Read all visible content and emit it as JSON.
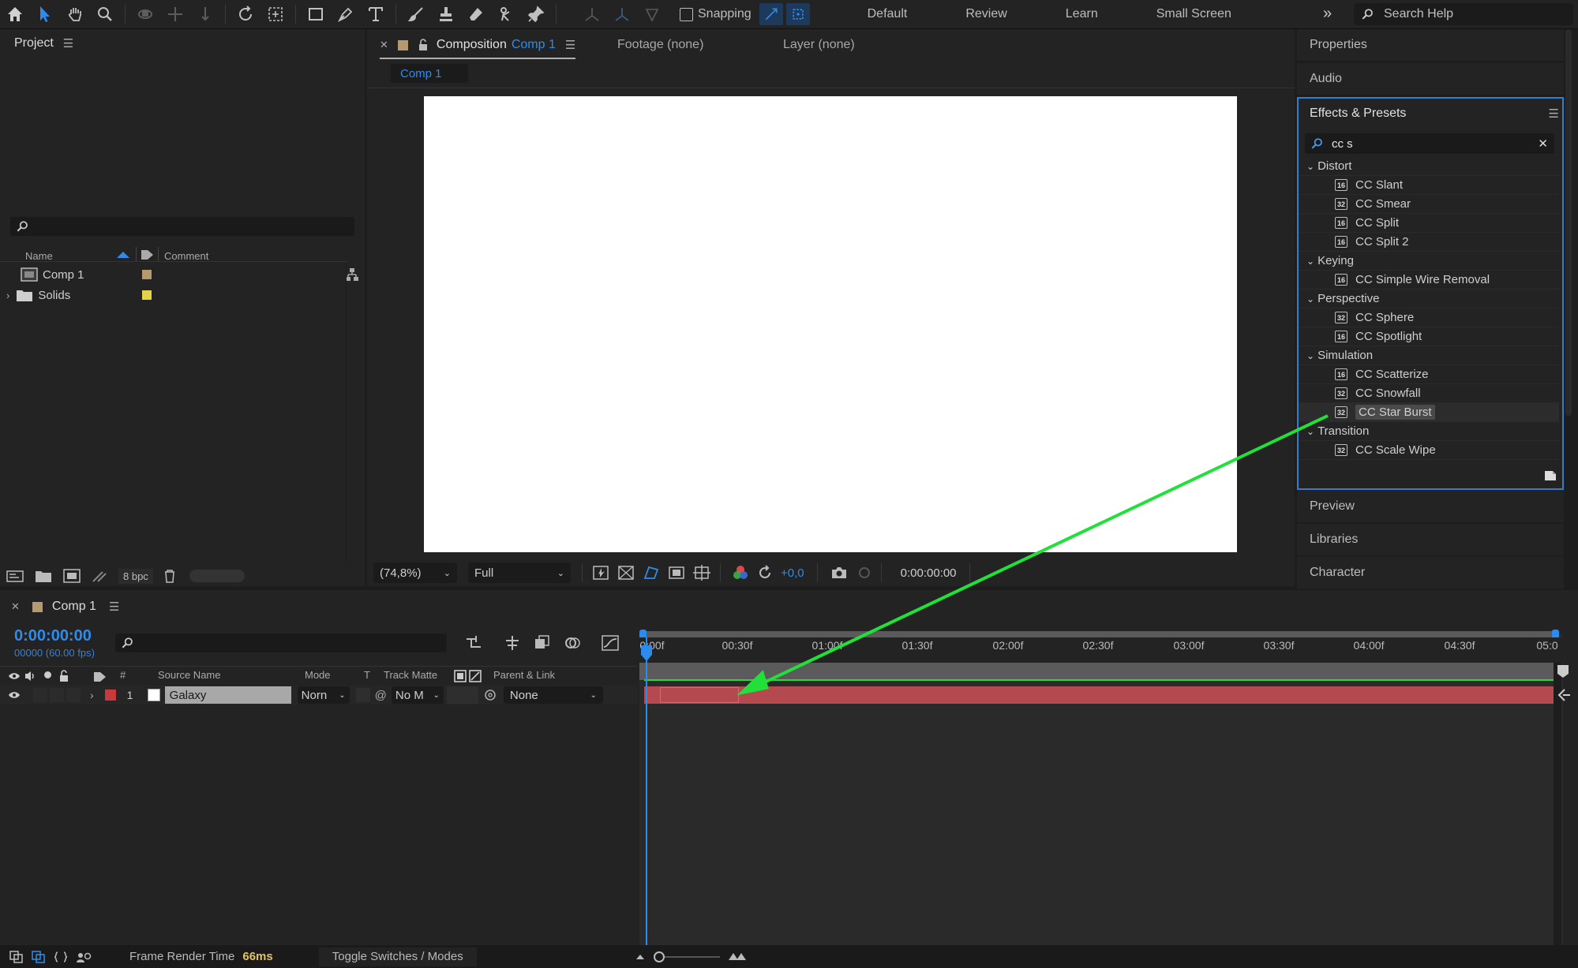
{
  "toolbar": {
    "tools": [
      "home-icon",
      "selection-tool-icon",
      "hand-tool-icon",
      "zoom-tool-icon",
      "orbit-camera-icon",
      "pan-camera-icon",
      "dolly-camera-icon",
      "rotation-tool-icon",
      "pan-behind-tool-icon",
      "rectangle-tool-icon",
      "pen-tool-icon",
      "type-tool-icon",
      "brush-tool-icon",
      "clone-stamp-icon",
      "eraser-icon",
      "roto-brush-icon",
      "puppet-pin-icon"
    ],
    "snapping_label": "Snapping",
    "workspaces": [
      "Default",
      "Review",
      "Learn",
      "Small Screen"
    ],
    "search_placeholder": "Search Help"
  },
  "project": {
    "title": "Project",
    "columns": {
      "name": "Name",
      "comment": "Comment"
    },
    "items": [
      {
        "name": "Comp 1",
        "type": "composition",
        "label_color": "#b49a6e"
      },
      {
        "name": "Solids",
        "type": "folder",
        "label_color": "#e3d24a"
      }
    ],
    "bpc": "8 bpc"
  },
  "viewer": {
    "tab_prefix": "Composition",
    "tab_comp": "Comp 1",
    "footage_tab": "Footage (none)",
    "layer_tab": "Layer (none)",
    "breadcrumb": "Comp 1",
    "zoom": "(74,8%)",
    "resolution": "Full",
    "exposure": "+0,0",
    "timecode": "0:00:00:00"
  },
  "right_panels": {
    "properties": "Properties",
    "audio": "Audio",
    "effects_title": "Effects & Presets",
    "search_value": "cc s",
    "tree": [
      {
        "category": "Distort",
        "items": [
          {
            "name": "CC Slant",
            "bit": "16"
          },
          {
            "name": "CC Smear",
            "bit": "32"
          },
          {
            "name": "CC Split",
            "bit": "16"
          },
          {
            "name": "CC Split 2",
            "bit": "16"
          }
        ]
      },
      {
        "category": "Keying",
        "items": [
          {
            "name": "CC Simple Wire Removal",
            "bit": "16"
          }
        ]
      },
      {
        "category": "Perspective",
        "items": [
          {
            "name": "CC Sphere",
            "bit": "32"
          },
          {
            "name": "CC Spotlight",
            "bit": "16"
          }
        ]
      },
      {
        "category": "Simulation",
        "items": [
          {
            "name": "CC Scatterize",
            "bit": "16"
          },
          {
            "name": "CC Snowfall",
            "bit": "32"
          },
          {
            "name": "CC Star Burst",
            "bit": "32",
            "selected": true
          }
        ]
      },
      {
        "category": "Transition",
        "items": [
          {
            "name": "CC Scale Wipe",
            "bit": "32"
          }
        ]
      }
    ],
    "preview": "Preview",
    "libraries": "Libraries",
    "character": "Character"
  },
  "timeline": {
    "comp_name": "Comp 1",
    "timecode": "0:00:00:00",
    "fps": "00000 (60.00 fps)",
    "columns": {
      "num": "#",
      "source": "Source Name",
      "mode": "Mode",
      "t": "T",
      "track_matte": "Track Matte",
      "parent": "Parent & Link"
    },
    "layer": {
      "index": "1",
      "name": "Galaxy",
      "mode": "Norn",
      "matte": "No M",
      "parent": "None",
      "label_color": "#c8393b"
    },
    "ruler_labels": [
      "0:00f",
      "00:30f",
      "01:00f",
      "01:30f",
      "02:00f",
      "02:30f",
      "03:00f",
      "03:30f",
      "04:00f",
      "04:30f",
      "05:0"
    ]
  },
  "status": {
    "render_label": "Frame Render Time",
    "render_value": "66ms",
    "toggle_label": "Toggle Switches / Modes"
  },
  "annotation": {
    "color": "#22e03a"
  }
}
